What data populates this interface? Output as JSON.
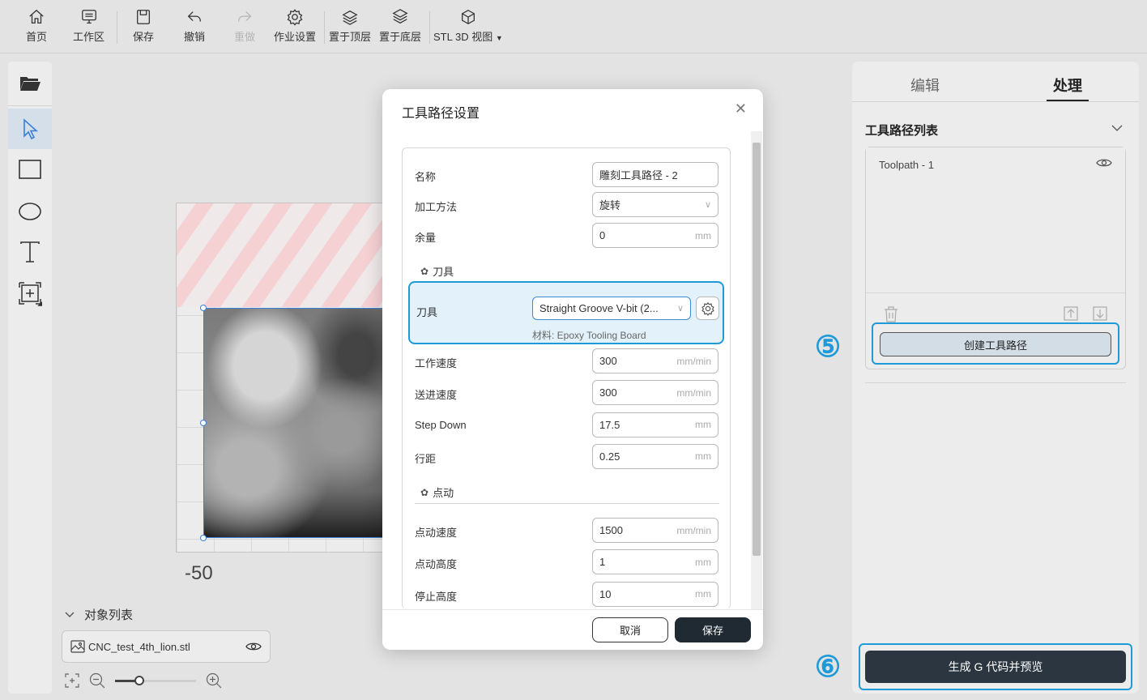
{
  "toolbar": {
    "home": "首页",
    "workspace": "工作区",
    "save": "保存",
    "undo": "撤销",
    "redo": "重做",
    "job_settings": "作业设置",
    "bring_to_front": "置于顶层",
    "send_to_back": "置于底层",
    "view_mode": "STL 3D 视图"
  },
  "canvas": {
    "axis_label": "-50"
  },
  "object_list": {
    "title": "对象列表",
    "items": [
      {
        "name": "CNC_test_4th_lion.stl"
      }
    ],
    "zoom_level": 0.3
  },
  "right_panel": {
    "tabs": [
      "编辑",
      "处理"
    ],
    "active_tab": "处理",
    "section_title": "工具路径列表",
    "toolpaths": [
      "Toolpath - 1"
    ],
    "create_button": "创建工具路径",
    "generate_button": "生成 G 代码并预览",
    "marker_5": "⑤",
    "marker_6": "⑥"
  },
  "dialog": {
    "title": "工具路径设置",
    "fields": {
      "name_label": "名称",
      "name_value": "雕刻工具路径 - 2",
      "method_label": "加工方法",
      "method_value": "旋转",
      "allowance_label": "余量",
      "allowance_value": "0",
      "allowance_unit": "mm"
    },
    "tool_section": "刀具",
    "tool": {
      "label": "刀具",
      "value": "Straight Groove V-bit (2...",
      "material": "材料: Epoxy Tooling Board"
    },
    "speed_rows": [
      {
        "label": "工作速度",
        "value": "300",
        "unit": "mm/min"
      },
      {
        "label": "送进速度",
        "value": "300",
        "unit": "mm/min"
      },
      {
        "label": "Step Down",
        "value": "17.5",
        "unit": "mm"
      },
      {
        "label": "行距",
        "value": "0.25",
        "unit": "mm"
      }
    ],
    "jog_section": "点动",
    "jog_rows": [
      {
        "label": "点动速度",
        "value": "1500",
        "unit": "mm/min"
      },
      {
        "label": "点动高度",
        "value": "1",
        "unit": "mm"
      },
      {
        "label": "停止高度",
        "value": "10",
        "unit": "mm"
      }
    ],
    "cancel": "取消",
    "save": "保存"
  },
  "colors": {
    "accent": "#1e9ad8",
    "primary_dark": "#2b3640"
  }
}
